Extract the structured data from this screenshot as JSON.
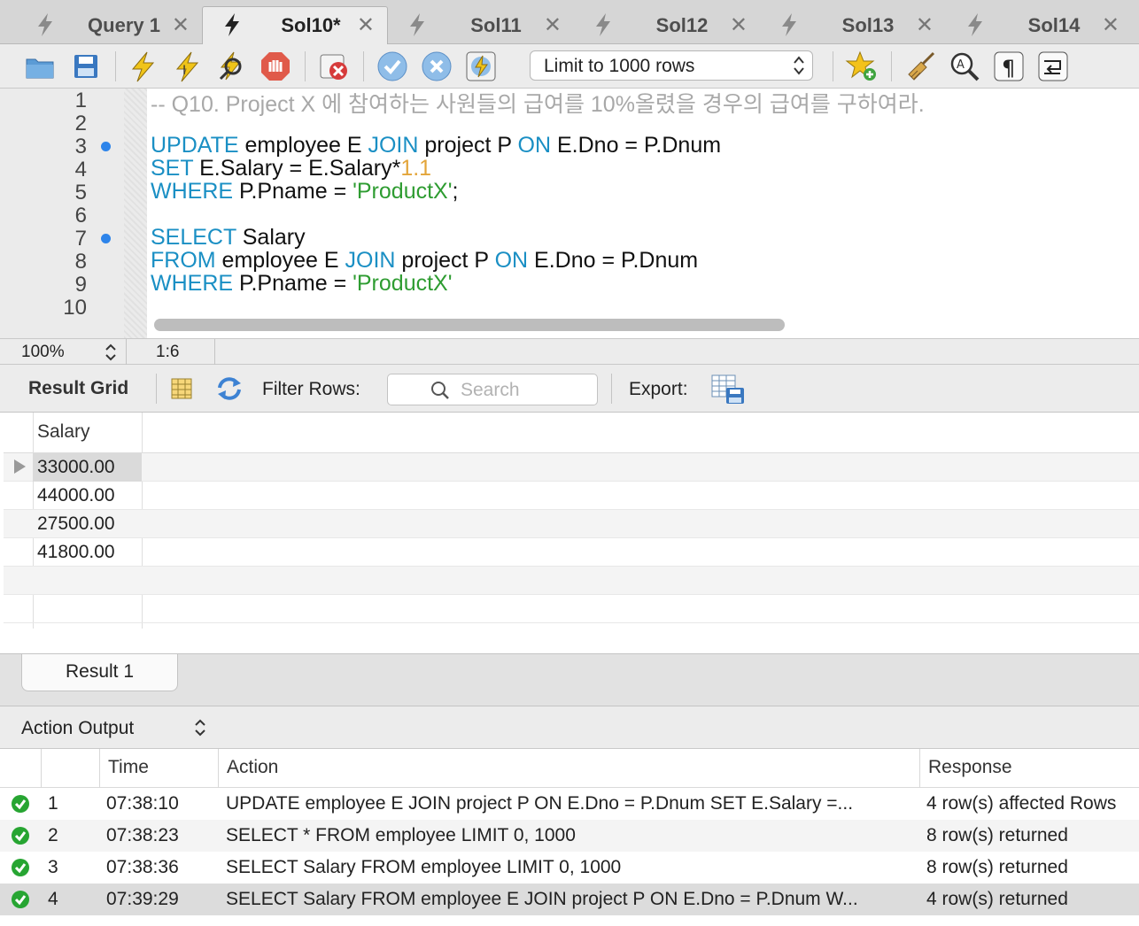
{
  "tabs": [
    {
      "label": "Query 1",
      "active": false
    },
    {
      "label": "Sol10*",
      "active": true
    },
    {
      "label": "Sol11",
      "active": false
    },
    {
      "label": "Sol12",
      "active": false
    },
    {
      "label": "Sol13",
      "active": false
    },
    {
      "label": "Sol14",
      "active": false
    }
  ],
  "toolbar": {
    "limit_select": "Limit to 1000 rows"
  },
  "editor": {
    "line_numbers": [
      "1",
      "2",
      "3",
      "4",
      "5",
      "6",
      "7",
      "8",
      "9",
      "10"
    ],
    "breakpoint_lines": [
      3,
      7
    ],
    "lines": {
      "l1_comment": "-- Q10. Project X 에 참여하는 사원들의 급여를 10%올렸을 경우의 급여를 구하여라.",
      "l3_kw1": "UPDATE",
      "l3_t1": " employee E ",
      "l3_kw2": "JOIN",
      "l3_t2": " project P ",
      "l3_kw3": "ON",
      "l3_t3": " E.Dno = P.Dnum",
      "l4_kw1": "SET",
      "l4_t1": " E.Salary = E.Salary*",
      "l4_num": "1.1",
      "l5_kw1": "WHERE",
      "l5_t1": " P.Pname = ",
      "l5_str": "'ProductX'",
      "l5_t2": ";",
      "l7_kw1": "SELECT",
      "l7_t1": " Salary",
      "l8_kw1": "FROM",
      "l8_t1": " employee E ",
      "l8_kw2": "JOIN",
      "l8_t2": " project P ",
      "l8_kw3": "ON",
      "l8_t3": " E.Dno = P.Dnum",
      "l9_kw1": "WHERE",
      "l9_t1": " P.Pname = ",
      "l9_str": "'ProductX'"
    }
  },
  "status": {
    "zoom": "100%",
    "cursor": "1:6"
  },
  "result_toolbar": {
    "grid_label": "Result Grid",
    "filter_label": "Filter Rows:",
    "search_placeholder": "Search",
    "export_label": "Export:"
  },
  "result_grid": {
    "column": "Salary",
    "rows": [
      "33000.00",
      "44000.00",
      "27500.00",
      "41800.00"
    ]
  },
  "result_tabs": [
    "Result 1"
  ],
  "action_output": {
    "label": "Action Output",
    "columns": {
      "time": "Time",
      "action": "Action",
      "response": "Response"
    },
    "rows": [
      {
        "n": "1",
        "time": "07:38:10",
        "action": "UPDATE employee E JOIN project P ON E.Dno = P.Dnum SET E.Salary =...",
        "response": "4 row(s) affected Rows"
      },
      {
        "n": "2",
        "time": "07:38:23",
        "action": "SELECT * FROM employee LIMIT 0, 1000",
        "response": "8 row(s) returned"
      },
      {
        "n": "3",
        "time": "07:38:36",
        "action": "SELECT Salary FROM employee LIMIT 0, 1000",
        "response": "8 row(s) returned"
      },
      {
        "n": "4",
        "time": "07:39:29",
        "action": "SELECT Salary FROM employee E JOIN project P ON E.Dno = P.Dnum W...",
        "response": "4 row(s) returned"
      }
    ]
  },
  "colors": {
    "keyword": "#1a8fc4",
    "string": "#2e9c31",
    "number": "#e3a53a",
    "comment": "#a8a8a8",
    "breakpoint": "#2d84ea",
    "success": "#27a532"
  }
}
